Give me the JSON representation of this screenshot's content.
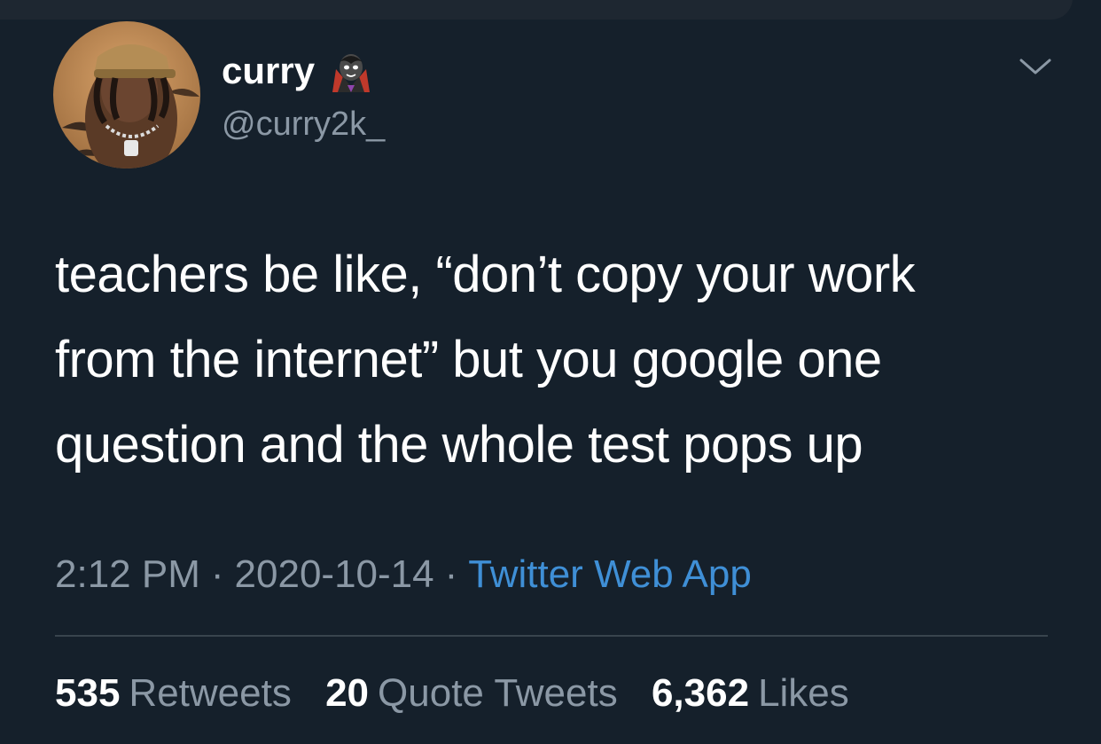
{
  "user": {
    "display_name": "curry",
    "handle": "@curry2k_",
    "avatar": "profile-photo-avatar",
    "name_emoji": "vampire-emoji-icon"
  },
  "tweet": {
    "lines": [
      "teachers be like, “don’t copy your work",
      "from the internet” but you google one",
      "question and the whole test pops up"
    ]
  },
  "meta": {
    "time": "2:12 PM",
    "separator": "·",
    "date": "2020-10-14",
    "source": "Twitter Web App"
  },
  "stats": {
    "retweets_count": "535",
    "retweets_label": "Retweets",
    "quote_count": "20",
    "quote_label": "Quote Tweets",
    "likes_count": "6,362",
    "likes_label": "Likes"
  },
  "colors": {
    "background": "#15202b",
    "secondary_text": "#8b98a5",
    "link": "#3f8fd6",
    "divider": "#38444d"
  },
  "icons": {
    "more_menu": "chevron-down-icon"
  }
}
